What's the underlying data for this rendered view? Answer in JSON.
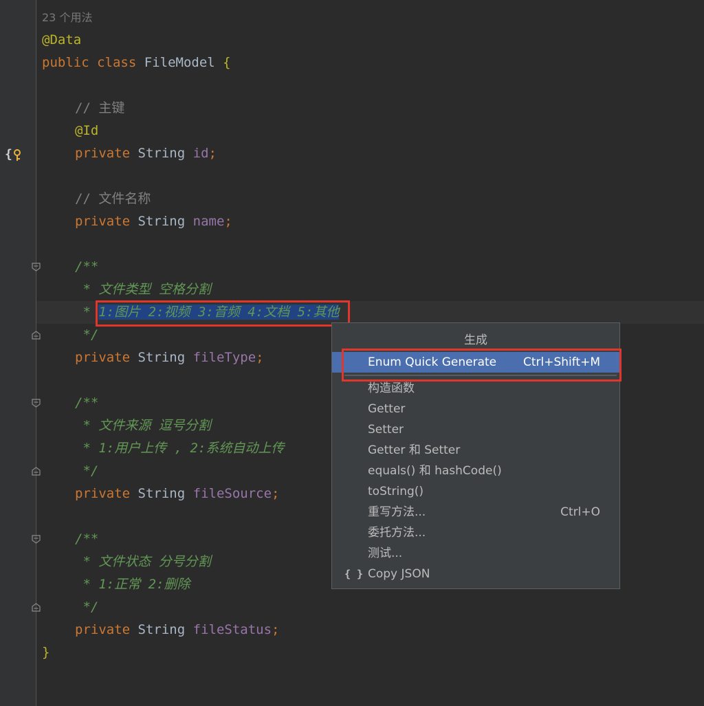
{
  "editor": {
    "usages_hint": "23 个用法",
    "class_annotation": "@Data",
    "class_kw_public": "public",
    "class_kw_class": "class",
    "class_name": "FileModel",
    "brace_open": "{",
    "brace_close": "}",
    "fields": {
      "id": {
        "comment": "// 主键",
        "annotation": "@Id",
        "kw": "private",
        "type": "String",
        "name": "id",
        "semi": ";"
      },
      "name": {
        "comment": "// 文件名称",
        "kw": "private",
        "type": "String",
        "name": "name",
        "semi": ";"
      },
      "fileType": {
        "doc_open": "/**",
        "doc_line1": " * 文件类型 空格分割",
        "doc_star": " * ",
        "doc_line2_selected": "1:图片 2:视频 3:音频 4:文档 5:其他",
        "doc_close": " */",
        "kw": "private",
        "type": "String",
        "name": "fileType",
        "semi": ";"
      },
      "fileSource": {
        "doc_open": "/**",
        "doc_line1": " * 文件来源 逗号分割",
        "doc_line2": " * 1:用户上传 , 2:系统自动上传",
        "doc_close": " */",
        "kw": "private",
        "type": "String",
        "name": "fileSource",
        "semi": ";"
      },
      "fileStatus": {
        "doc_open": "/**",
        "doc_line1": " * 文件状态 分号分割",
        "doc_line2": " * 1:正常 2:删除",
        "doc_close": " */",
        "kw": "private",
        "type": "String",
        "name": "fileStatus",
        "semi": ";"
      }
    }
  },
  "generate_menu": {
    "title": "生成",
    "items": [
      {
        "label": "Enum Quick Generate",
        "shortcut": "Ctrl+Shift+M",
        "active": true
      },
      {
        "label": "构造函数",
        "shortcut": ""
      },
      {
        "label": "Getter",
        "shortcut": ""
      },
      {
        "label": "Setter",
        "shortcut": ""
      },
      {
        "label": "Getter 和 Setter",
        "shortcut": ""
      },
      {
        "label": "equals() 和 hashCode()",
        "shortcut": ""
      },
      {
        "label": "toString()",
        "shortcut": ""
      },
      {
        "label": "重写方法...",
        "shortcut": "Ctrl+O"
      },
      {
        "label": "委托方法...",
        "shortcut": ""
      },
      {
        "label": "测试...",
        "shortcut": ""
      },
      {
        "label": "Copy JSON",
        "shortcut": "",
        "icon": "{ }"
      }
    ]
  },
  "colors": {
    "editor_bg": "#2b2b2b",
    "keyword": "#cc7832",
    "annotation": "#bbb529",
    "field": "#9876aa",
    "doc_comment": "#629755",
    "selection": "#214283",
    "highlight_box": "#e0362c",
    "menu_active": "#4b6eaf"
  }
}
